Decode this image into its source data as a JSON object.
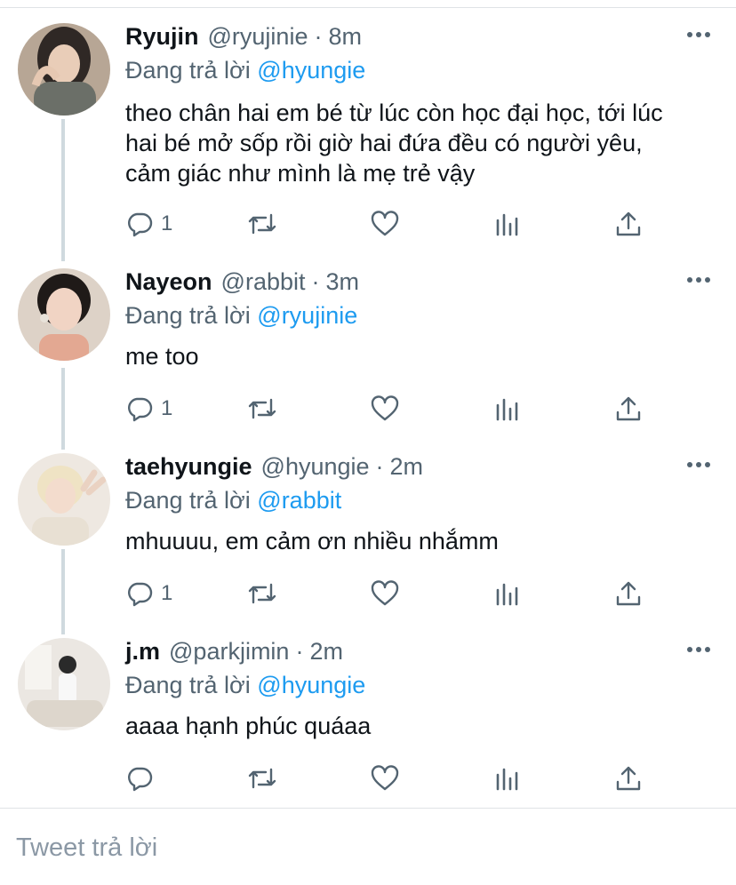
{
  "reply_prefix": "Đang trả lời",
  "tweets": [
    {
      "name": "Ryujin",
      "handle": "@ryujinie",
      "time": "8m",
      "reply_to": "@hyungie",
      "text": "theo chân hai em bé từ lúc còn học đại học, tới lúc hai bé mở sốp rồi giờ hai đứa đều có người yêu, cảm giác như mình là mẹ trẻ vậy",
      "reply_count": "1",
      "avatar_colors": [
        "#3a3330",
        "#c9b5a3"
      ]
    },
    {
      "name": "Nayeon",
      "handle": "@rabbit",
      "time": "3m",
      "reply_to": "@ryujinie",
      "text": "me too",
      "reply_count": "1",
      "avatar_colors": [
        "#d8c6b4",
        "#e9b9a5"
      ]
    },
    {
      "name": "taehyungie",
      "handle": "@hyungie",
      "time": "2m",
      "reply_to": "@rabbit",
      "text": "mhuuuu, em cảm ơn nhiều nhắmm",
      "reply_count": "1",
      "avatar_colors": [
        "#e6ddd2",
        "#f0e2c0"
      ]
    },
    {
      "name": "j.m",
      "handle": "@parkjimin",
      "time": "2m",
      "reply_to": "@hyungie",
      "text": "aaaa hạnh phúc quáaa",
      "reply_count": "",
      "avatar_colors": [
        "#ece9e4",
        "#2b2b2b"
      ]
    }
  ],
  "composer": {
    "placeholder": "Tweet trả lời"
  },
  "icons": {
    "reply": "comment-bubble-icon",
    "retweet": "retweet-icon",
    "like": "heart-icon",
    "analytics": "analytics-bars-icon",
    "share": "share-upload-icon",
    "more": "more-dots-icon"
  },
  "colors": {
    "mention": "#1d9bf0",
    "secondary_text": "#536471",
    "thread_line": "#cfd9de"
  }
}
